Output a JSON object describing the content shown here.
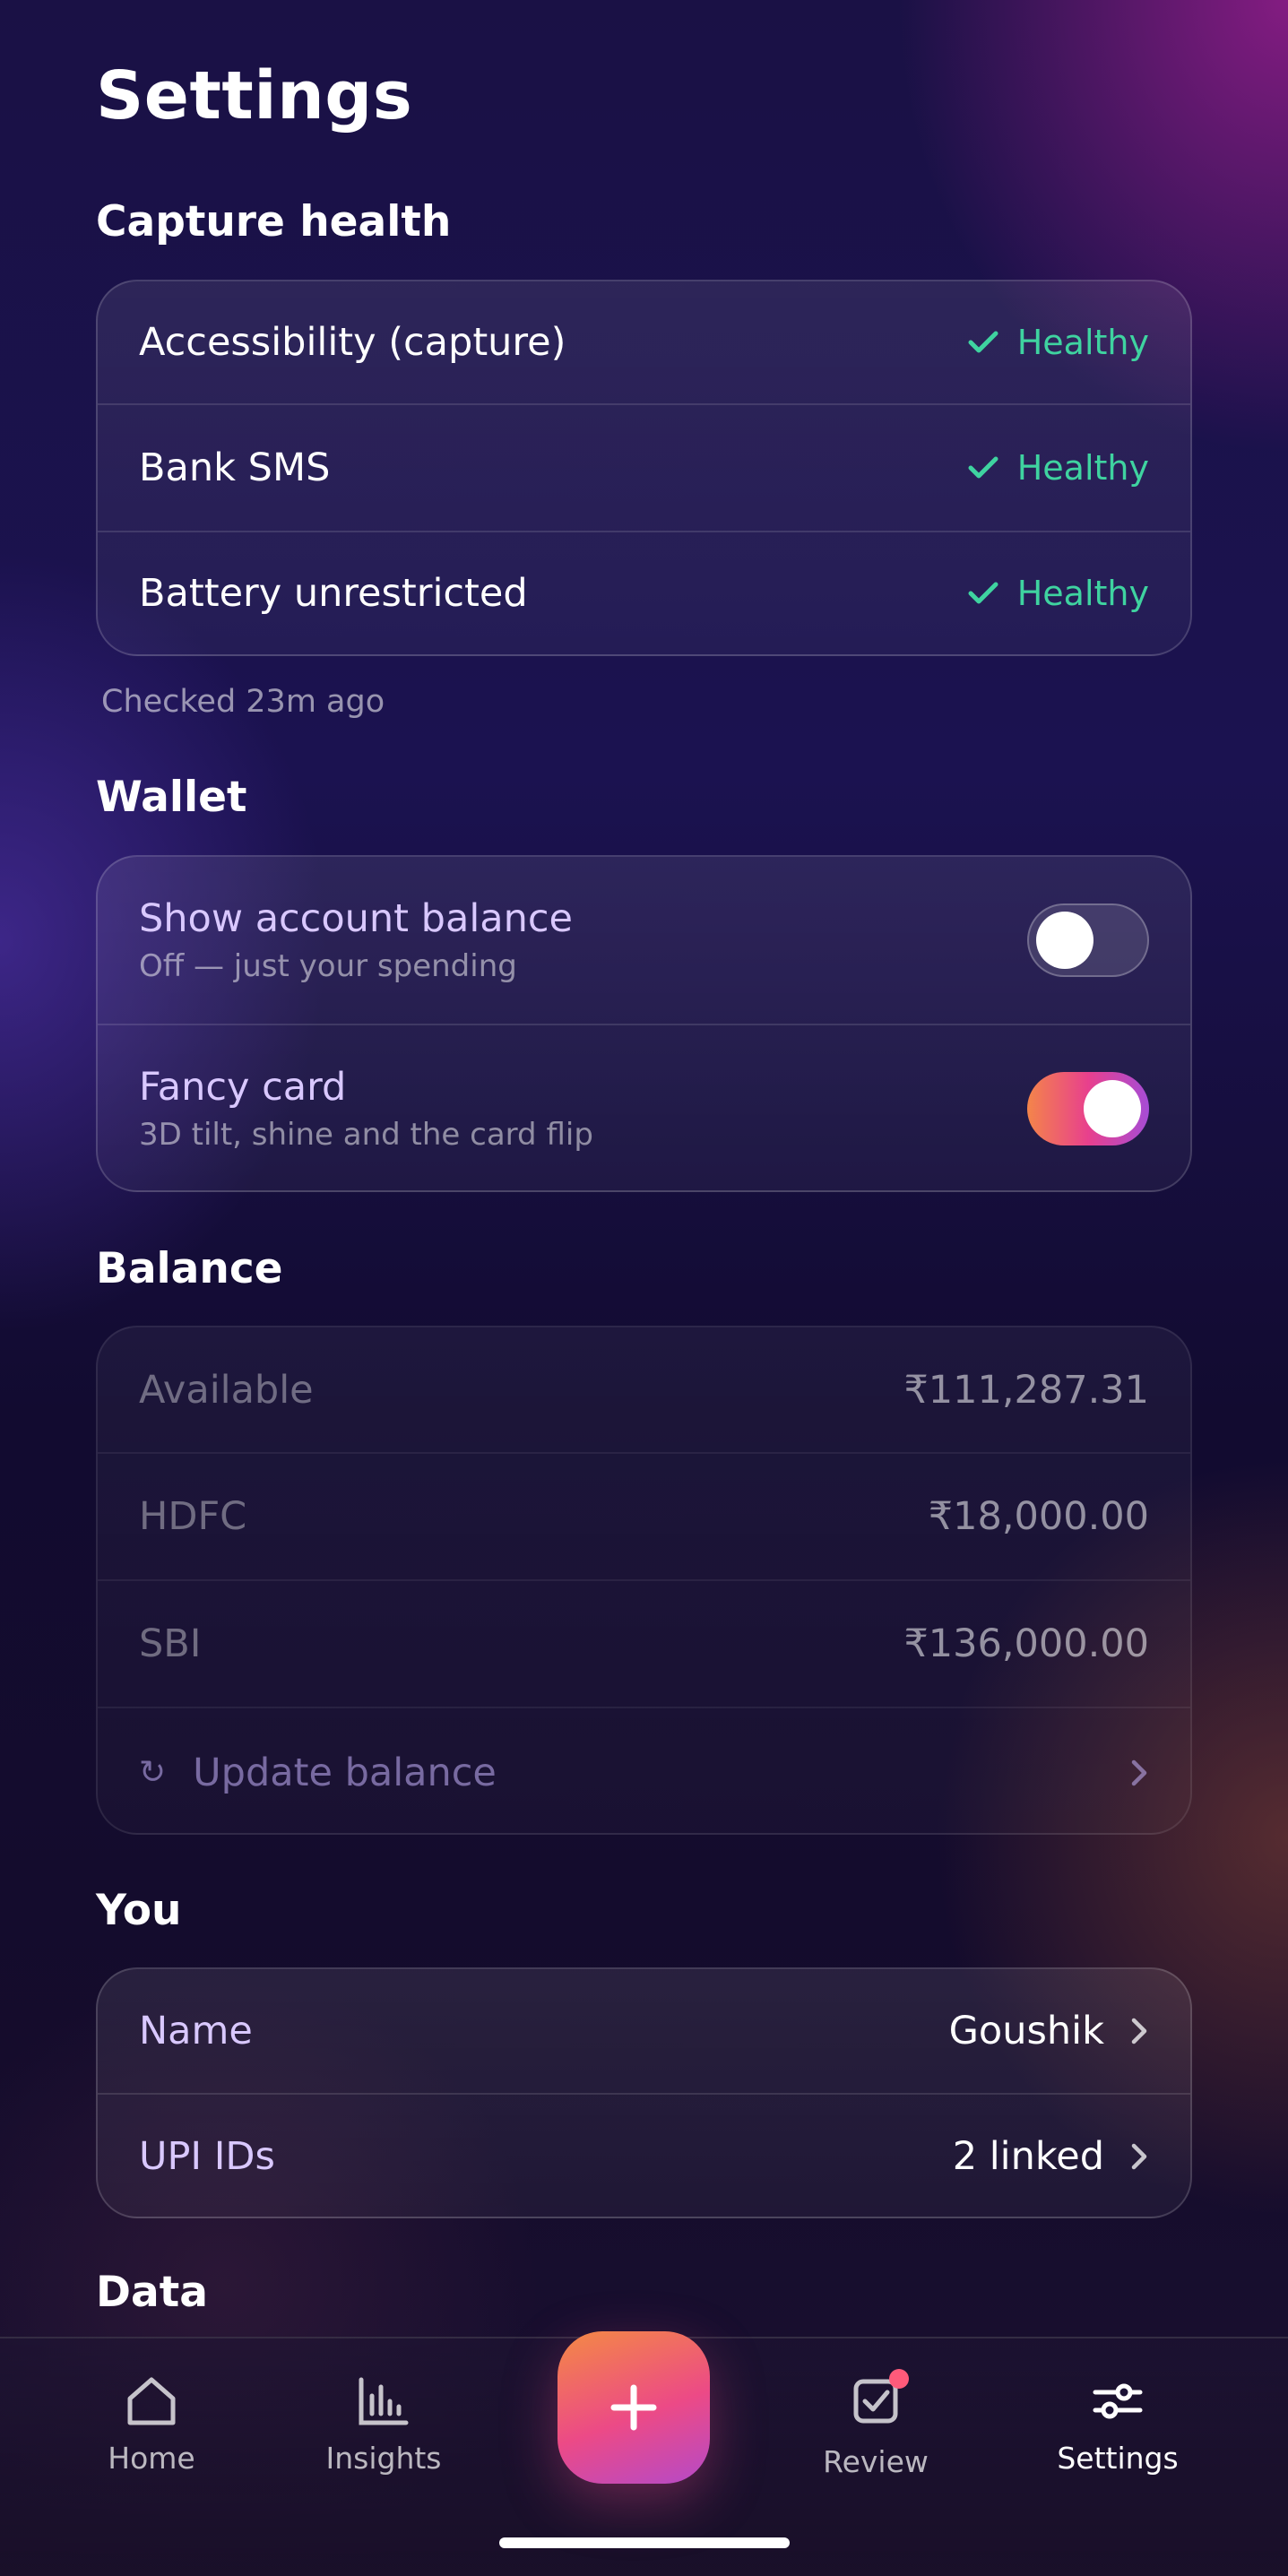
{
  "page": {
    "title": "Settings"
  },
  "capture_health": {
    "title": "Capture health",
    "items": [
      {
        "label": "Accessibility (capture)",
        "status": "Healthy"
      },
      {
        "label": "Bank SMS",
        "status": "Healthy"
      },
      {
        "label": "Battery unrestricted",
        "status": "Healthy"
      }
    ],
    "checked_note": "Checked 23m ago"
  },
  "wallet": {
    "title": "Wallet",
    "items": [
      {
        "label": "Show account balance",
        "sub": "Off — just your spending",
        "enabled": false
      },
      {
        "label": "Fancy card",
        "sub": "3D tilt, shine and the card flip",
        "enabled": true
      }
    ]
  },
  "balance": {
    "title": "Balance",
    "rows": [
      {
        "label": "Available",
        "amount": "₹111,287.31"
      },
      {
        "label": "HDFC",
        "amount": "₹18,000.00"
      },
      {
        "label": "SBI",
        "amount": "₹136,000.00"
      }
    ],
    "update_label": "Update balance",
    "refresh_glyph": "↻"
  },
  "you": {
    "title": "You",
    "rows": [
      {
        "label": "Name",
        "value": "Goushik"
      },
      {
        "label": "UPI IDs",
        "value": "2 linked"
      }
    ]
  },
  "data_section": {
    "title": "Data"
  },
  "nav": {
    "items": [
      {
        "label": "Home",
        "icon": "home-icon"
      },
      {
        "label": "Insights",
        "icon": "bar-chart-icon"
      },
      {
        "label": "Review",
        "icon": "checkbox-icon"
      },
      {
        "label": "Settings",
        "icon": "sliders-icon",
        "active": true
      }
    ],
    "fab_icon": "plus-icon"
  },
  "colors": {
    "healthy": "#3fd3a0",
    "accent_gradient_start": "#f4854a",
    "accent_gradient_end": "#b54ac8"
  }
}
